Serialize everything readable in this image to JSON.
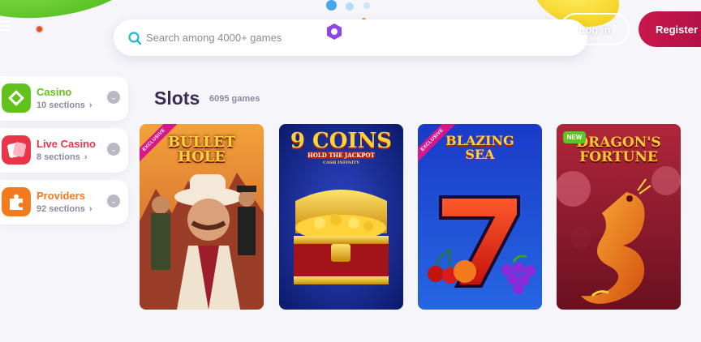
{
  "header": {
    "logo_text": "",
    "search": {
      "placeholder": "Search among 4000+ games"
    },
    "login_label": "Log in",
    "register_label": "Register"
  },
  "sidebar": {
    "items": [
      {
        "label": "Casino",
        "sub": "10 sections",
        "color": "#62c21c",
        "icon": "casino-icon"
      },
      {
        "label": "Live Casino",
        "sub": "8 sections",
        "color": "#e8354a",
        "icon": "live-casino-icon"
      },
      {
        "label": "Providers",
        "sub": "92 sections",
        "color": "#f47a1e",
        "icon": "providers-icon"
      }
    ]
  },
  "main": {
    "section_title": "Slots",
    "section_count": "6095 games",
    "games": [
      {
        "title": "BULLET HOLE",
        "badge": "EXCLUSIVE"
      },
      {
        "title": "9 COINS",
        "subtitle": "HOLD THE JACKPOT",
        "tag": "CASH INFINITY",
        "badge": ""
      },
      {
        "title": "BLAZING SEA",
        "badge": "EXCLUSIVE"
      },
      {
        "title": "DRAGON'S FORTUNE",
        "badge": "NEW"
      }
    ]
  },
  "colors": {
    "accent": "#3a2a55",
    "register": "#c8174a",
    "muted": "#8c88a0"
  }
}
